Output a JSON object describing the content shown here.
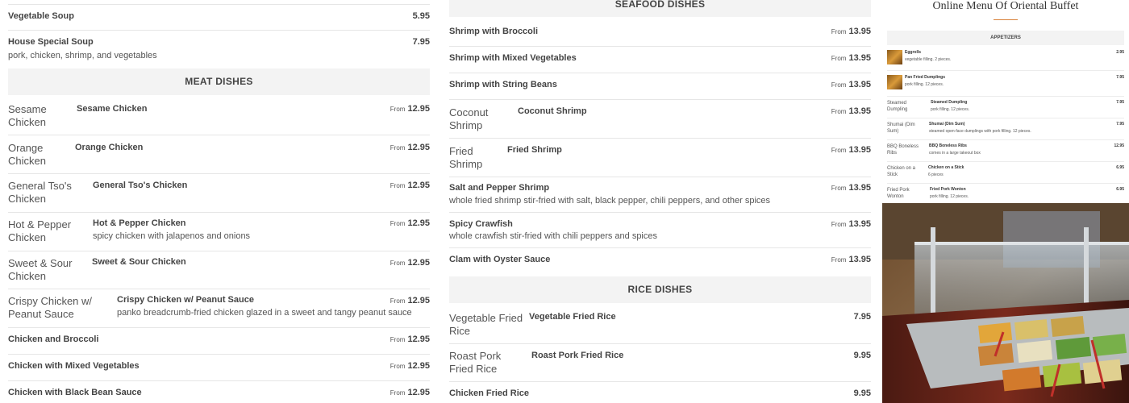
{
  "left_column": {
    "items_top": [
      {
        "name": "Vegetable Soup",
        "price": "5.95"
      },
      {
        "name": "House Special Soup",
        "desc": "pork, chicken, shrimp, and vegetables",
        "price": "7.95"
      }
    ],
    "meat_heading": "MEAT DISHES",
    "meat_items": [
      {
        "alt": "Sesame Chicken",
        "name": "Sesame Chicken",
        "from": "From",
        "price": "12.95"
      },
      {
        "alt": "Orange Chicken",
        "name": "Orange Chicken",
        "from": "From",
        "price": "12.95"
      },
      {
        "alt": "General Tso's Chicken",
        "name": "General Tso's Chicken",
        "from": "From",
        "price": "12.95"
      },
      {
        "alt": "Hot & Pepper Chicken",
        "name": "Hot & Pepper Chicken",
        "desc": "spicy chicken with jalapenos and onions",
        "from": "From",
        "price": "12.95"
      },
      {
        "alt": "Sweet & Sour Chicken",
        "name": "Sweet & Sour Chicken",
        "from": "From",
        "price": "12.95"
      },
      {
        "alt": "Crispy Chicken w/ Peanut Sauce",
        "name": "Crispy Chicken w/ Peanut Sauce",
        "desc": "panko breadcrumb-fried chicken glazed in a sweet and tangy peanut sauce",
        "from": "From",
        "price": "12.95"
      },
      {
        "name": "Chicken and Broccoli",
        "from": "From",
        "price": "12.95"
      },
      {
        "name": "Chicken with Mixed Vegetables",
        "from": "From",
        "price": "12.95"
      },
      {
        "name": "Chicken with Black Bean Sauce",
        "from": "From",
        "price": "12.95"
      }
    ]
  },
  "mid_column": {
    "seafood_heading": "SEAFOOD DISHES",
    "seafood_items": [
      {
        "name": "Shrimp with Broccoli",
        "from": "From",
        "price": "13.95"
      },
      {
        "name": "Shrimp with Mixed Vegetables",
        "from": "From",
        "price": "13.95"
      },
      {
        "name": "Shrimp with String Beans",
        "from": "From",
        "price": "13.95"
      },
      {
        "alt": "Coconut Shrimp",
        "name": "Coconut Shrimp",
        "from": "From",
        "price": "13.95"
      },
      {
        "alt": "Fried Shrimp",
        "name": "Fried Shrimp",
        "from": "From",
        "price": "13.95"
      },
      {
        "name": "Salt and Pepper Shrimp",
        "desc": "whole fried shrimp stir-fried with salt, black pepper, chili peppers, and other spices",
        "from": "From",
        "price": "13.95"
      },
      {
        "name": "Spicy Crawfish",
        "desc": "whole crawfish stir-fried with chili peppers and spices",
        "from": "From",
        "price": "13.95"
      },
      {
        "name": "Clam with Oyster Sauce",
        "from": "From",
        "price": "13.95"
      }
    ],
    "rice_heading": "RICE DISHES",
    "rice_items": [
      {
        "alt": "Vegetable Fried Rice",
        "name": "Vegetable Fried Rice",
        "price": "7.95"
      },
      {
        "alt": "Roast Pork Fried Rice",
        "name": "Roast Pork Fried Rice",
        "price": "9.95"
      },
      {
        "name": "Chicken Fried Rice",
        "price": "9.95"
      }
    ]
  },
  "right_panel": {
    "title": "Online Menu Of Oriental Buffet",
    "accent_color": "#d9823b",
    "appetizers_heading": "APPETIZERS",
    "appetizers": [
      {
        "name": "Eggrolls",
        "desc": "vegetable filling. 2 pieces.",
        "price": "2.95"
      },
      {
        "name": "Pan Fried Dumplings",
        "desc": "pork filling. 12 pieces.",
        "price": "7.95"
      },
      {
        "alt": "Steamed Dumpling",
        "name": "Steamed Dumpling",
        "desc": "pork filling. 12 pieces.",
        "price": "7.95"
      },
      {
        "alt": "Shumai (Dim Sum)",
        "name": "Shumai (Dim Sum)",
        "desc": "steamed open-face dumplings with pork filling. 12 pieces.",
        "price": "7.95"
      },
      {
        "alt": "BBQ Boneless Ribs",
        "name": "BBQ Boneless Ribs",
        "desc": "comes in a large takeout box",
        "price": "12.95"
      },
      {
        "alt": "Chicken on a Stick",
        "name": "Chicken on a Stick",
        "desc": "6 pieces",
        "price": "6.95"
      },
      {
        "alt": "Fried Pork Wonton",
        "name": "Fried Pork Wonton",
        "desc": "pork filling. 12 pieces.",
        "price": "6.95"
      }
    ]
  }
}
